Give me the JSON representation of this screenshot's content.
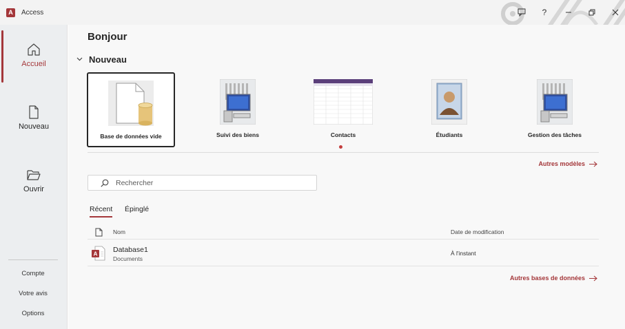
{
  "window": {
    "app_icon_letter": "A",
    "title": "Access",
    "buttons": [
      "feedback-icon",
      "help-icon",
      "minimize-icon",
      "restore-icon",
      "close-icon"
    ],
    "help_label": "?"
  },
  "colors": {
    "accent": "#a4373a",
    "sidebar_bg": "#eceef0",
    "main_bg": "#f8f8f8"
  },
  "sidebar": {
    "nav": [
      {
        "label": "Accueil",
        "icon": "home-icon",
        "active": true
      },
      {
        "label": "Nouveau",
        "icon": "new-document-icon"
      },
      {
        "label": "Ouvrir",
        "icon": "folder-open-icon"
      }
    ],
    "bottom": [
      {
        "label": "Compte"
      },
      {
        "label": "Votre avis"
      },
      {
        "label": "Options"
      }
    ]
  },
  "main": {
    "greeting": "Bonjour",
    "new_section": {
      "title": "Nouveau",
      "chevron": "chevron-down-icon"
    },
    "templates": [
      {
        "label": "Base de données vide",
        "icon": "blank-database-icon",
        "selected": true
      },
      {
        "label": "Suivi des biens",
        "icon": "computer-asset-icon"
      },
      {
        "label": "Contacts",
        "icon": "contacts-table-icon",
        "pinned": true
      },
      {
        "label": "Étudiants",
        "icon": "student-contact-icon"
      },
      {
        "label": "Gestion des tâches",
        "icon": "computer-task-icon"
      }
    ],
    "more_templates": "Autres modèles",
    "search": {
      "placeholder": "Rechercher",
      "value": ""
    },
    "tabs": [
      {
        "label": "Récent",
        "active": true
      },
      {
        "label": "Épinglé"
      }
    ],
    "list": {
      "columns": {
        "name": "Nom",
        "modified": "Date de modification"
      },
      "rows": [
        {
          "name": "Database1",
          "location": "Documents",
          "modified": "À l'instant",
          "icon": "access-file-icon"
        }
      ]
    },
    "more_databases": "Autres bases de données"
  }
}
